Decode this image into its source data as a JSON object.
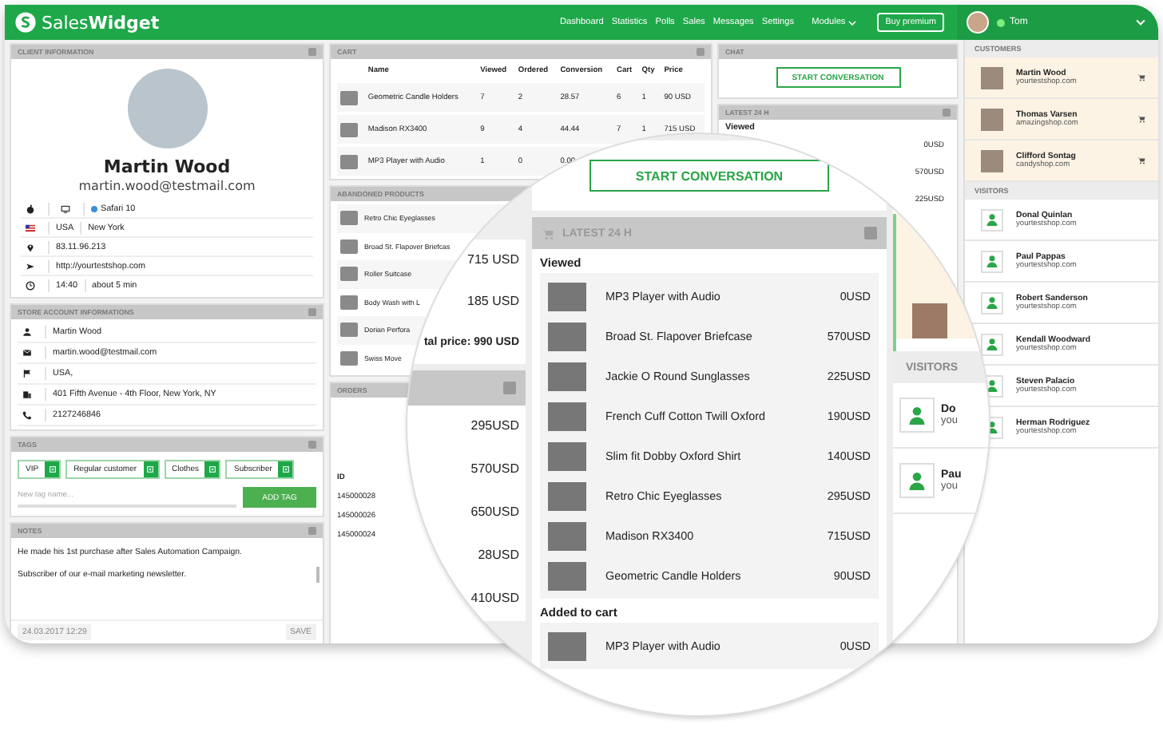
{
  "topbar": {
    "logo_light": "Sales",
    "logo_bold": "Widget",
    "nav": [
      "Dashboard",
      "Statistics",
      "Polls",
      "Sales",
      "Messages",
      "Settings"
    ],
    "modules": "Modules",
    "premium": "Buy premium",
    "user": "Tom",
    "online": true
  },
  "client": {
    "title": "CLIENT INFORMATION",
    "name": "Martin Wood",
    "email": "martin.wood@testmail.com",
    "browser": "Safari 10",
    "country": "USA",
    "city": "New York",
    "ip": "83.11.96.213",
    "url": "http://yourtestshop.com",
    "time": "14:40",
    "duration": "about 5 min"
  },
  "store": {
    "title": "STORE ACCOUNT INFORMATIONS",
    "rows": [
      {
        "kind": "person",
        "text": "Martin Wood"
      },
      {
        "kind": "mail",
        "text": "martin.wood@testmail.com"
      },
      {
        "kind": "flag",
        "text": "USA,"
      },
      {
        "kind": "building",
        "text": "401 Fifth Avenue - 4th Floor, New York, NY"
      },
      {
        "kind": "phone",
        "text": "2127246846"
      }
    ]
  },
  "tags": {
    "title": "TAGS",
    "items": [
      "VIP",
      "Regular customer",
      "Clothes",
      "Subscriber"
    ],
    "placeholder": "New tag name...",
    "button": "ADD TAG"
  },
  "notes": {
    "title": "NOTES",
    "lines": [
      "He made his 1st purchase after Sales Automation Campaign.",
      "Subscriber of our e-mail marketing newsletter."
    ],
    "date": "24.03.2017 12:29",
    "button": "SAVE"
  },
  "cart": {
    "title": "CART",
    "columns": [
      "Name",
      "Viewed",
      "Ordered",
      "Conversion",
      "Cart",
      "Qty",
      "Price"
    ],
    "rows": [
      [
        "Geometric Candle Holders",
        "7",
        "2",
        "28.57",
        "6",
        "1",
        "90 USD"
      ],
      [
        "Madison RX3400",
        "9",
        "4",
        "44.44",
        "7",
        "1",
        "715 USD"
      ],
      [
        "MP3 Player with Audio",
        "1",
        "0",
        "0.00"
      ]
    ]
  },
  "abandoned": {
    "title": "ABANDONED PRODUCTS",
    "items": [
      "Retro Chic Eyeglasses",
      "Broad St. Flapover Briefcas",
      "Roller Suitcase",
      "Body Wash with L",
      "Dorian Perfora",
      "Swiss Move"
    ]
  },
  "orders": {
    "title": "ORDERS",
    "id_label": "ID",
    "ids": [
      "145000028",
      "145000026",
      "145000024"
    ]
  },
  "chat": {
    "title": "CHAT",
    "button": "START CONVERSATION"
  },
  "latest": {
    "title": "LATEST 24 H",
    "label": "Viewed",
    "prices": [
      "0USD",
      "570USD",
      "225USD"
    ]
  },
  "sidebar": {
    "customers_title": "CUSTOMERS",
    "customers": [
      {
        "name": "Martin Wood",
        "site": "yourtestshop.com"
      },
      {
        "name": "Thomas Varsen",
        "site": "amazingshop.com"
      },
      {
        "name": "Clifford Sontag",
        "site": "candyshop.com"
      }
    ],
    "visitors_title": "VISITORS",
    "visitors": [
      {
        "name": "Donal Quinlan",
        "site": "yourtestshop.com"
      },
      {
        "name": "Paul Pappas",
        "site": "yourtestshop.com"
      },
      {
        "name": "Robert Sanderson",
        "site": "yourtestshop.com"
      },
      {
        "name": "Kendall Woodward",
        "site": "yourtestshop.com"
      },
      {
        "name": "Steven Palacio",
        "site": "yourtestshop.com"
      },
      {
        "name": "Herman Rodriguez",
        "site": "yourtestshop.com"
      }
    ]
  },
  "magnifier": {
    "cart_prices": [
      "715 USD",
      "185 USD"
    ],
    "total": "tal price: 990 USD",
    "order_values": [
      "295USD",
      "570USD",
      "650USD",
      "28USD",
      "410USD"
    ],
    "button": "START CONVERSATION",
    "title": "LATEST 24 H",
    "sections": [
      {
        "label": "Viewed",
        "items": [
          {
            "name": "MP3 Player with Audio",
            "price": "0USD"
          },
          {
            "name": "Broad St. Flapover Briefcase",
            "price": "570USD"
          },
          {
            "name": "Jackie O Round Sunglasses",
            "price": "225USD"
          },
          {
            "name": "French Cuff Cotton Twill Oxford",
            "price": "190USD"
          },
          {
            "name": "Slim fit Dobby Oxford Shirt",
            "price": "140USD"
          },
          {
            "name": "Retro Chic Eyeglasses",
            "price": "295USD"
          },
          {
            "name": "Madison RX3400",
            "price": "715USD"
          },
          {
            "name": "Geometric Candle Holders",
            "price": "90USD"
          }
        ]
      },
      {
        "label": "Added to cart",
        "items": [
          {
            "name": "MP3 Player with Audio",
            "price": "0USD"
          }
        ]
      }
    ],
    "visitors_title": "VISITORS",
    "visitors": [
      {
        "name": "Do",
        "site": "you"
      },
      {
        "name": "Pau",
        "site": "you"
      }
    ]
  }
}
